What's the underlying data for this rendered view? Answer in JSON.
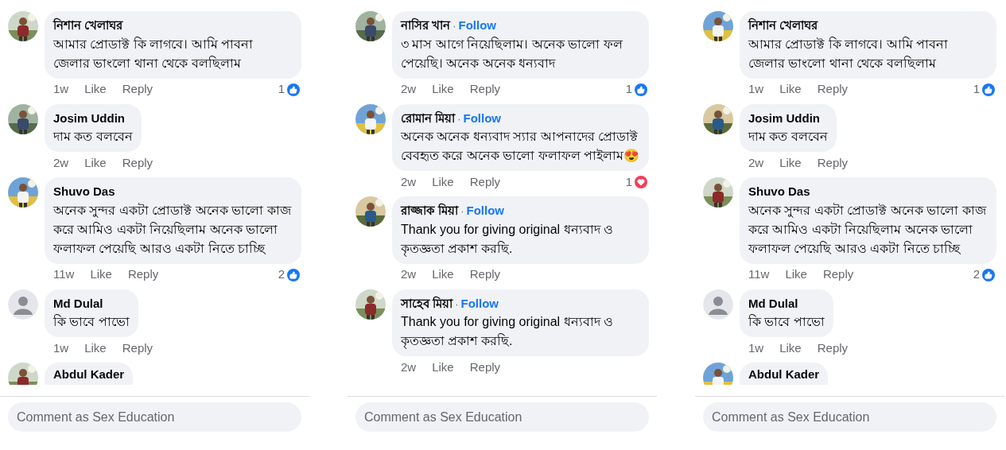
{
  "panels": [
    {
      "comments": [
        {
          "author": "নিশান খেলাঘর",
          "default_avatar": false,
          "text": "আমার প্রোডাক্ট কি লাগবে। আমি পাবনা জেলার ভাংলো থানা থেকে বলছিলাম",
          "time": "1w",
          "like": "Like",
          "reply": "Reply",
          "reactions": {
            "count": "1",
            "kind": "like"
          }
        },
        {
          "author": "Josim Uddin",
          "default_avatar": false,
          "text": "দাম কত বলবেন",
          "time": "2w",
          "like": "Like",
          "reply": "Reply"
        },
        {
          "author": "Shuvo Das",
          "default_avatar": false,
          "text": "অনেক সুন্দর একটা প্রোডাক্ট অনেক ভালো কাজ করে আমিও একটা নিয়েছিলাম অনেক ভালো ফলাফল পেয়েছি আরও একটা নিতে চাচ্ছি",
          "time": "11w",
          "like": "Like",
          "reply": "Reply",
          "reactions": {
            "count": "2",
            "kind": "like"
          }
        },
        {
          "author": "Md Dulal",
          "default_avatar": true,
          "text": "কি ভাবে পাভো",
          "time": "1w",
          "like": "Like",
          "reply": "Reply"
        },
        {
          "author": "Abdul Kader",
          "default_avatar": false
        }
      ],
      "composer": {
        "placeholder": "Comment as Sex Education"
      }
    },
    {
      "comments": [
        {
          "author": "নাসির খান",
          "separator": "·",
          "follow_label": "Follow",
          "default_avatar": false,
          "text": "৩ মাস আগে নিয়েছিলাম। অনেক ভালো ফল পেয়েছি।  অনেক অনেক ধন্যবাদ",
          "time": "2w",
          "like": "Like",
          "reply": "Reply",
          "reactions": {
            "count": "1",
            "kind": "like"
          }
        },
        {
          "author": "রোমান মিয়া",
          "separator": "·",
          "follow_label": "Follow",
          "default_avatar": false,
          "text": "অনেক অনেক ধন্যবাদ স্যার আপনাদের প্রোডাক্ট  বেবহৃত  করে অনেক ভালো ফলাফল পাইলাম😍",
          "time": "2w",
          "like": "Like",
          "reply": "Reply",
          "reactions": {
            "count": "1",
            "kind": "love"
          }
        },
        {
          "author": "রাজ্জাক মিয়া",
          "separator": "·",
          "follow_label": "Follow",
          "default_avatar": false,
          "text": "Thank you for giving original ধন্যবাদ ও কৃতজ্ঞতা প্রকাশ করছি.",
          "time": "2w",
          "like": "Like",
          "reply": "Reply"
        },
        {
          "author": "সাহেব মিয়া",
          "separator": "·",
          "follow_label": "Follow",
          "default_avatar": false,
          "text": "Thank you for giving original ধন্যবাদ ও কৃতজ্ঞতা প্রকাশ করছি.",
          "time": "2w",
          "like": "Like",
          "reply": "Reply"
        }
      ],
      "composer": {
        "placeholder": "Comment as Sex Education"
      }
    },
    {
      "comments": [
        {
          "author": "নিশান খেলাঘর",
          "default_avatar": false,
          "text": "আমার প্রোডাক্ট কি লাগবে। আমি পাবনা জেলার ভাংলো থানা থেকে বলছিলাম",
          "time": "1w",
          "like": "Like",
          "reply": "Reply",
          "reactions": {
            "count": "1",
            "kind": "like"
          }
        },
        {
          "author": "Josim Uddin",
          "default_avatar": false,
          "text": "দাম কত বলবেন",
          "time": "2w",
          "like": "Like",
          "reply": "Reply"
        },
        {
          "author": "Shuvo Das",
          "default_avatar": false,
          "text": "অনেক সুন্দর একটা প্রোডাক্ট অনেক ভালো কাজ করে আমিও একটা নিয়েছিলাম অনেক ভালো ফলাফল পেয়েছি আরও একটা নিতে চাচ্ছি",
          "time": "11w",
          "like": "Like",
          "reply": "Reply",
          "reactions": {
            "count": "2",
            "kind": "like"
          }
        },
        {
          "author": "Md Dulal",
          "default_avatar": true,
          "text": "কি ভাবে পাভো",
          "time": "1w",
          "like": "Like",
          "reply": "Reply"
        },
        {
          "author": "Abdul Kader",
          "default_avatar": false
        }
      ],
      "composer": {
        "placeholder": "Comment as Sex Education"
      }
    }
  ]
}
